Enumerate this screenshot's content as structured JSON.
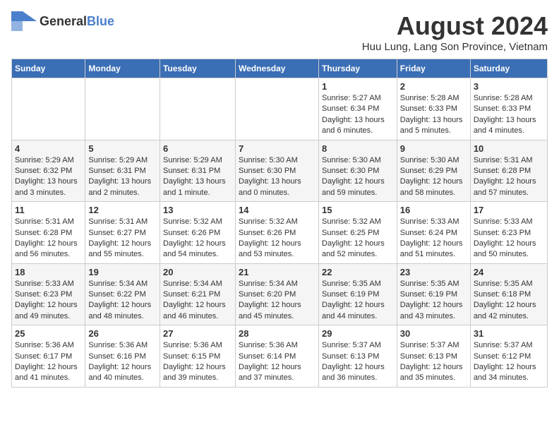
{
  "logo": {
    "general": "General",
    "blue": "Blue"
  },
  "title": "August 2024",
  "subtitle": "Huu Lung, Lang Son Province, Vietnam",
  "headers": [
    "Sunday",
    "Monday",
    "Tuesday",
    "Wednesday",
    "Thursday",
    "Friday",
    "Saturday"
  ],
  "weeks": [
    [
      {
        "day": "",
        "info": ""
      },
      {
        "day": "",
        "info": ""
      },
      {
        "day": "",
        "info": ""
      },
      {
        "day": "",
        "info": ""
      },
      {
        "day": "1",
        "sunrise": "5:27 AM",
        "sunset": "6:34 PM",
        "daylight": "13 hours and 6 minutes."
      },
      {
        "day": "2",
        "sunrise": "5:28 AM",
        "sunset": "6:33 PM",
        "daylight": "13 hours and 5 minutes."
      },
      {
        "day": "3",
        "sunrise": "5:28 AM",
        "sunset": "6:33 PM",
        "daylight": "13 hours and 4 minutes."
      }
    ],
    [
      {
        "day": "4",
        "sunrise": "5:29 AM",
        "sunset": "6:32 PM",
        "daylight": "13 hours and 3 minutes."
      },
      {
        "day": "5",
        "sunrise": "5:29 AM",
        "sunset": "6:31 PM",
        "daylight": "13 hours and 2 minutes."
      },
      {
        "day": "6",
        "sunrise": "5:29 AM",
        "sunset": "6:31 PM",
        "daylight": "13 hours and 1 minute."
      },
      {
        "day": "7",
        "sunrise": "5:30 AM",
        "sunset": "6:30 PM",
        "daylight": "13 hours and 0 minutes."
      },
      {
        "day": "8",
        "sunrise": "5:30 AM",
        "sunset": "6:30 PM",
        "daylight": "12 hours and 59 minutes."
      },
      {
        "day": "9",
        "sunrise": "5:30 AM",
        "sunset": "6:29 PM",
        "daylight": "12 hours and 58 minutes."
      },
      {
        "day": "10",
        "sunrise": "5:31 AM",
        "sunset": "6:28 PM",
        "daylight": "12 hours and 57 minutes."
      }
    ],
    [
      {
        "day": "11",
        "sunrise": "5:31 AM",
        "sunset": "6:28 PM",
        "daylight": "12 hours and 56 minutes."
      },
      {
        "day": "12",
        "sunrise": "5:31 AM",
        "sunset": "6:27 PM",
        "daylight": "12 hours and 55 minutes."
      },
      {
        "day": "13",
        "sunrise": "5:32 AM",
        "sunset": "6:26 PM",
        "daylight": "12 hours and 54 minutes."
      },
      {
        "day": "14",
        "sunrise": "5:32 AM",
        "sunset": "6:26 PM",
        "daylight": "12 hours and 53 minutes."
      },
      {
        "day": "15",
        "sunrise": "5:32 AM",
        "sunset": "6:25 PM",
        "daylight": "12 hours and 52 minutes."
      },
      {
        "day": "16",
        "sunrise": "5:33 AM",
        "sunset": "6:24 PM",
        "daylight": "12 hours and 51 minutes."
      },
      {
        "day": "17",
        "sunrise": "5:33 AM",
        "sunset": "6:23 PM",
        "daylight": "12 hours and 50 minutes."
      }
    ],
    [
      {
        "day": "18",
        "sunrise": "5:33 AM",
        "sunset": "6:23 PM",
        "daylight": "12 hours and 49 minutes."
      },
      {
        "day": "19",
        "sunrise": "5:34 AM",
        "sunset": "6:22 PM",
        "daylight": "12 hours and 48 minutes."
      },
      {
        "day": "20",
        "sunrise": "5:34 AM",
        "sunset": "6:21 PM",
        "daylight": "12 hours and 46 minutes."
      },
      {
        "day": "21",
        "sunrise": "5:34 AM",
        "sunset": "6:20 PM",
        "daylight": "12 hours and 45 minutes."
      },
      {
        "day": "22",
        "sunrise": "5:35 AM",
        "sunset": "6:19 PM",
        "daylight": "12 hours and 44 minutes."
      },
      {
        "day": "23",
        "sunrise": "5:35 AM",
        "sunset": "6:19 PM",
        "daylight": "12 hours and 43 minutes."
      },
      {
        "day": "24",
        "sunrise": "5:35 AM",
        "sunset": "6:18 PM",
        "daylight": "12 hours and 42 minutes."
      }
    ],
    [
      {
        "day": "25",
        "sunrise": "5:36 AM",
        "sunset": "6:17 PM",
        "daylight": "12 hours and 41 minutes."
      },
      {
        "day": "26",
        "sunrise": "5:36 AM",
        "sunset": "6:16 PM",
        "daylight": "12 hours and 40 minutes."
      },
      {
        "day": "27",
        "sunrise": "5:36 AM",
        "sunset": "6:15 PM",
        "daylight": "12 hours and 39 minutes."
      },
      {
        "day": "28",
        "sunrise": "5:36 AM",
        "sunset": "6:14 PM",
        "daylight": "12 hours and 37 minutes."
      },
      {
        "day": "29",
        "sunrise": "5:37 AM",
        "sunset": "6:13 PM",
        "daylight": "12 hours and 36 minutes."
      },
      {
        "day": "30",
        "sunrise": "5:37 AM",
        "sunset": "6:13 PM",
        "daylight": "12 hours and 35 minutes."
      },
      {
        "day": "31",
        "sunrise": "5:37 AM",
        "sunset": "6:12 PM",
        "daylight": "12 hours and 34 minutes."
      }
    ]
  ]
}
